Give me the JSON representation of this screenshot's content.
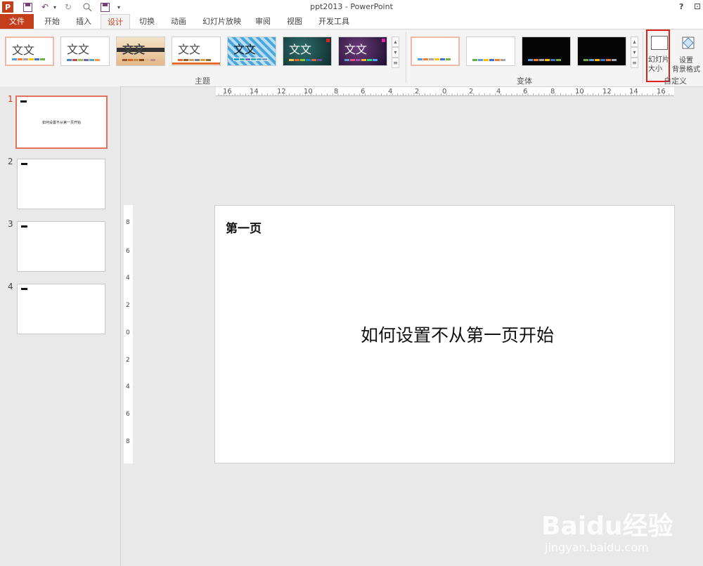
{
  "window": {
    "title": "ppt2013 - PowerPoint",
    "help": "?",
    "restore": "⊡"
  },
  "qat": [
    "powerpoint-logo-icon",
    "save-icon",
    "undo-icon",
    "redo-icon",
    "preview-icon",
    "save-as-icon",
    "customize-icon"
  ],
  "tabs": [
    {
      "label": "文件"
    },
    {
      "label": "开始"
    },
    {
      "label": "插入"
    },
    {
      "label": "设计"
    },
    {
      "label": "切换"
    },
    {
      "label": "动画"
    },
    {
      "label": "幻灯片放映"
    },
    {
      "label": "审阅"
    },
    {
      "label": "视图"
    },
    {
      "label": "开发工具"
    }
  ],
  "ribbon": {
    "themes_group_label": "主题",
    "variants_group_label": "变体",
    "customize_group_label": "自定义",
    "theme_text": "文文",
    "slide_size_label_1": "幻灯片",
    "slide_size_label_2": "大小",
    "bg_format_label_1": "设置",
    "bg_format_label_2": "背景格式"
  },
  "slides": [
    {
      "number": "1",
      "subtitle": "如何设置不从第一页开始"
    },
    {
      "number": "2"
    },
    {
      "number": "3"
    },
    {
      "number": "4"
    }
  ],
  "ruler": {
    "horizontal": [
      "16",
      "14",
      "12",
      "10",
      "8",
      "6",
      "4",
      "2",
      "0",
      "2",
      "4",
      "6",
      "8",
      "10",
      "12",
      "14",
      "16"
    ],
    "vertical": [
      "8",
      "6",
      "4",
      "2",
      "0",
      "2",
      "4",
      "6",
      "8"
    ]
  },
  "current_slide": {
    "title": "第一页",
    "subtitle": "如何设置不从第一页开始"
  },
  "watermark": {
    "logo": "Baidu经验",
    "url": "jingyan.baidu.com"
  },
  "colors": {
    "accent": "#c43e1c",
    "highlight_box": "#e0201e"
  }
}
